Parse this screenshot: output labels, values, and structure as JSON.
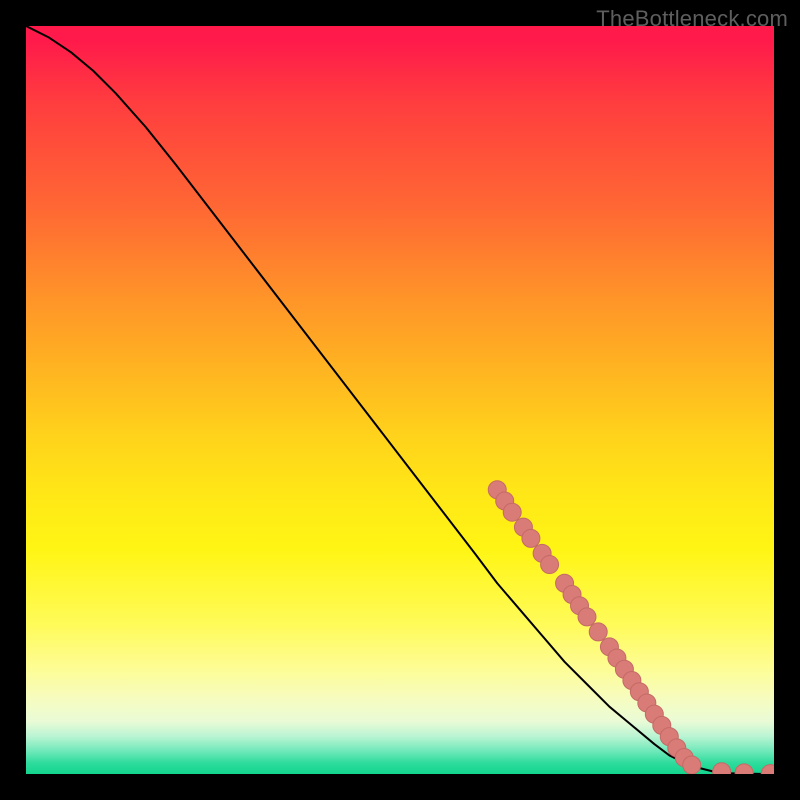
{
  "attribution": "TheBottleneck.com",
  "colors": {
    "line": "#000000",
    "marker_fill": "#d97b77",
    "marker_stroke": "#c46a66"
  },
  "chart_data": {
    "type": "line",
    "title": "",
    "xlabel": "",
    "ylabel": "",
    "xlim": [
      0,
      100
    ],
    "ylim": [
      0,
      100
    ],
    "grid": false,
    "legend": false,
    "series": [
      {
        "name": "curve",
        "x": [
          0,
          3,
          6,
          9,
          12,
          16,
          20,
          25,
          30,
          35,
          40,
          45,
          50,
          55,
          60,
          63,
          66,
          69,
          72,
          75,
          78,
          81,
          84,
          86,
          88,
          90,
          92,
          94,
          96,
          98,
          100
        ],
        "y": [
          100,
          98.5,
          96.5,
          94,
          91,
          86.5,
          81.5,
          75,
          68.5,
          62,
          55.5,
          49,
          42.5,
          36,
          29.5,
          25.5,
          22,
          18.5,
          15,
          12,
          9,
          6.5,
          4,
          2.5,
          1.5,
          0.8,
          0.3,
          0.1,
          0.05,
          0.02,
          0
        ]
      }
    ],
    "markers": [
      {
        "x": 63,
        "y": 38
      },
      {
        "x": 64,
        "y": 36.5
      },
      {
        "x": 65,
        "y": 35
      },
      {
        "x": 66.5,
        "y": 33
      },
      {
        "x": 67.5,
        "y": 31.5
      },
      {
        "x": 69,
        "y": 29.5
      },
      {
        "x": 70,
        "y": 28
      },
      {
        "x": 72,
        "y": 25.5
      },
      {
        "x": 73,
        "y": 24
      },
      {
        "x": 74,
        "y": 22.5
      },
      {
        "x": 75,
        "y": 21
      },
      {
        "x": 76.5,
        "y": 19
      },
      {
        "x": 78,
        "y": 17
      },
      {
        "x": 79,
        "y": 15.5
      },
      {
        "x": 80,
        "y": 14
      },
      {
        "x": 81,
        "y": 12.5
      },
      {
        "x": 82,
        "y": 11
      },
      {
        "x": 83,
        "y": 9.5
      },
      {
        "x": 84,
        "y": 8
      },
      {
        "x": 85,
        "y": 6.5
      },
      {
        "x": 86,
        "y": 5
      },
      {
        "x": 87,
        "y": 3.5
      },
      {
        "x": 88,
        "y": 2.2
      },
      {
        "x": 89,
        "y": 1.2
      },
      {
        "x": 93,
        "y": 0.3
      },
      {
        "x": 96,
        "y": 0.15
      },
      {
        "x": 99.5,
        "y": 0.05
      }
    ]
  }
}
